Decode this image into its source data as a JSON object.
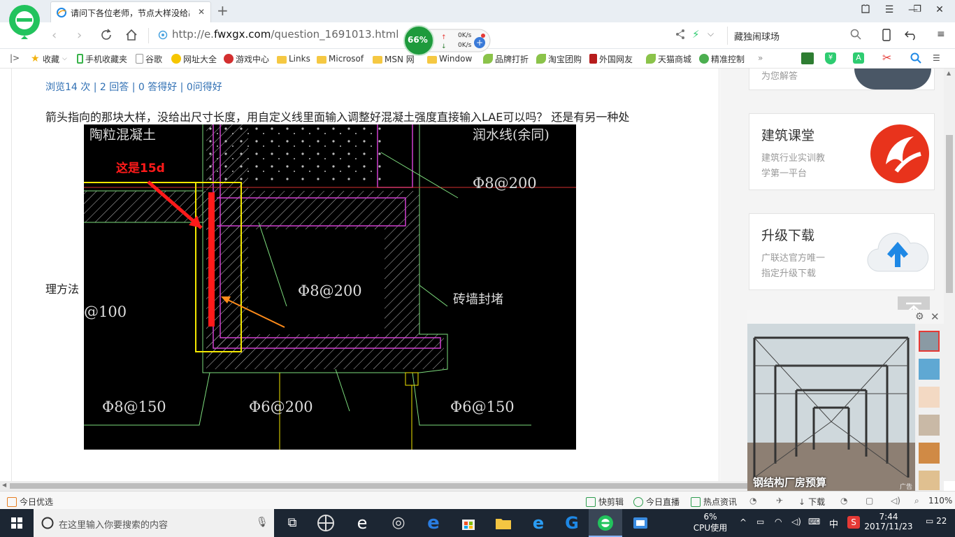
{
  "browser": {
    "tab_title": "请问下各位老师，节点大样没给出",
    "url_prefix": "http://e.",
    "url_domain": "fwxgx.com",
    "url_path": "/question_1691013.html",
    "speed_percent": "66%",
    "upload_speed": "0K/s",
    "download_speed": "0K/s",
    "search_text": "藏独闹球场"
  },
  "bookmarks": [
    {
      "label": "收藏",
      "color": "#f2b20f"
    },
    {
      "label": "手机收藏夹",
      "color": "#38b34a"
    },
    {
      "label": "谷歌",
      "color": "#9aa0a6"
    },
    {
      "label": "网址大全",
      "color": "#e33b2e"
    },
    {
      "label": "游戏中心",
      "color": "#d32f2f"
    },
    {
      "label": "Links",
      "color": "#f5c842"
    },
    {
      "label": "Microsof",
      "color": "#f5c842"
    },
    {
      "label": "MSN 网",
      "color": "#f5c842"
    },
    {
      "label": "Window",
      "color": "#f5c842"
    },
    {
      "label": "品牌打折",
      "color": "#8bc34a"
    },
    {
      "label": "淘宝团购",
      "color": "#8bc34a"
    },
    {
      "label": "外国网友",
      "color": "#b71c1c"
    },
    {
      "label": "天猫商城",
      "color": "#8bc34a"
    },
    {
      "label": "精准控制",
      "color": "#4caf50"
    }
  ],
  "page": {
    "stats": "浏览14 次 | 2 回答 | 0 答得好 | 0问得好",
    "question_line1": "箭头指向的那块大样，没给出尺寸长度，用自定义线里面输入调整好混凝土强度直接输入LAE可以吗？ 还是有另一种处",
    "question_line2": "理方法",
    "cad": {
      "annotation": "这是15d",
      "label_top_left": "陶粒混凝土",
      "label_top_right": "润水线(余同)",
      "label_rebar_1": "Φ8@200",
      "label_rebar_2": "Φ8@200",
      "label_wall": "砖墙封堵",
      "label_left": "@100",
      "label_bottom_1": "Φ8@150",
      "label_bottom_2": "Φ6@200",
      "label_bottom_3": "Φ6@150"
    }
  },
  "sidebar": {
    "card0_sub": "为您解答",
    "card1": {
      "title": "建筑课堂",
      "sub1": "建筑行业实训教",
      "sub2": "学第一平台"
    },
    "card2": {
      "title": "升级下载",
      "sub1": "广联达官方唯一",
      "sub2": "指定升级下载"
    }
  },
  "ad": {
    "caption": "钢结构厂房预算",
    "tag": "广告"
  },
  "statusbar": {
    "left": "今日优选",
    "kuaijianji": "快剪辑",
    "live": "今日直播",
    "news": "热点资讯",
    "download": "下载",
    "zoom": "110%"
  },
  "taskbar": {
    "search_placeholder": "在这里输入你要搜索的内容",
    "cpu_percent": "6%",
    "cpu_label": "CPU使用",
    "ime": "中",
    "time": "7:44",
    "date": "2017/11/23",
    "notifications": "22"
  },
  "colors": {
    "accent": "#2f6fb3",
    "taskbar": "#1c2633",
    "cad_bg": "#000000"
  }
}
